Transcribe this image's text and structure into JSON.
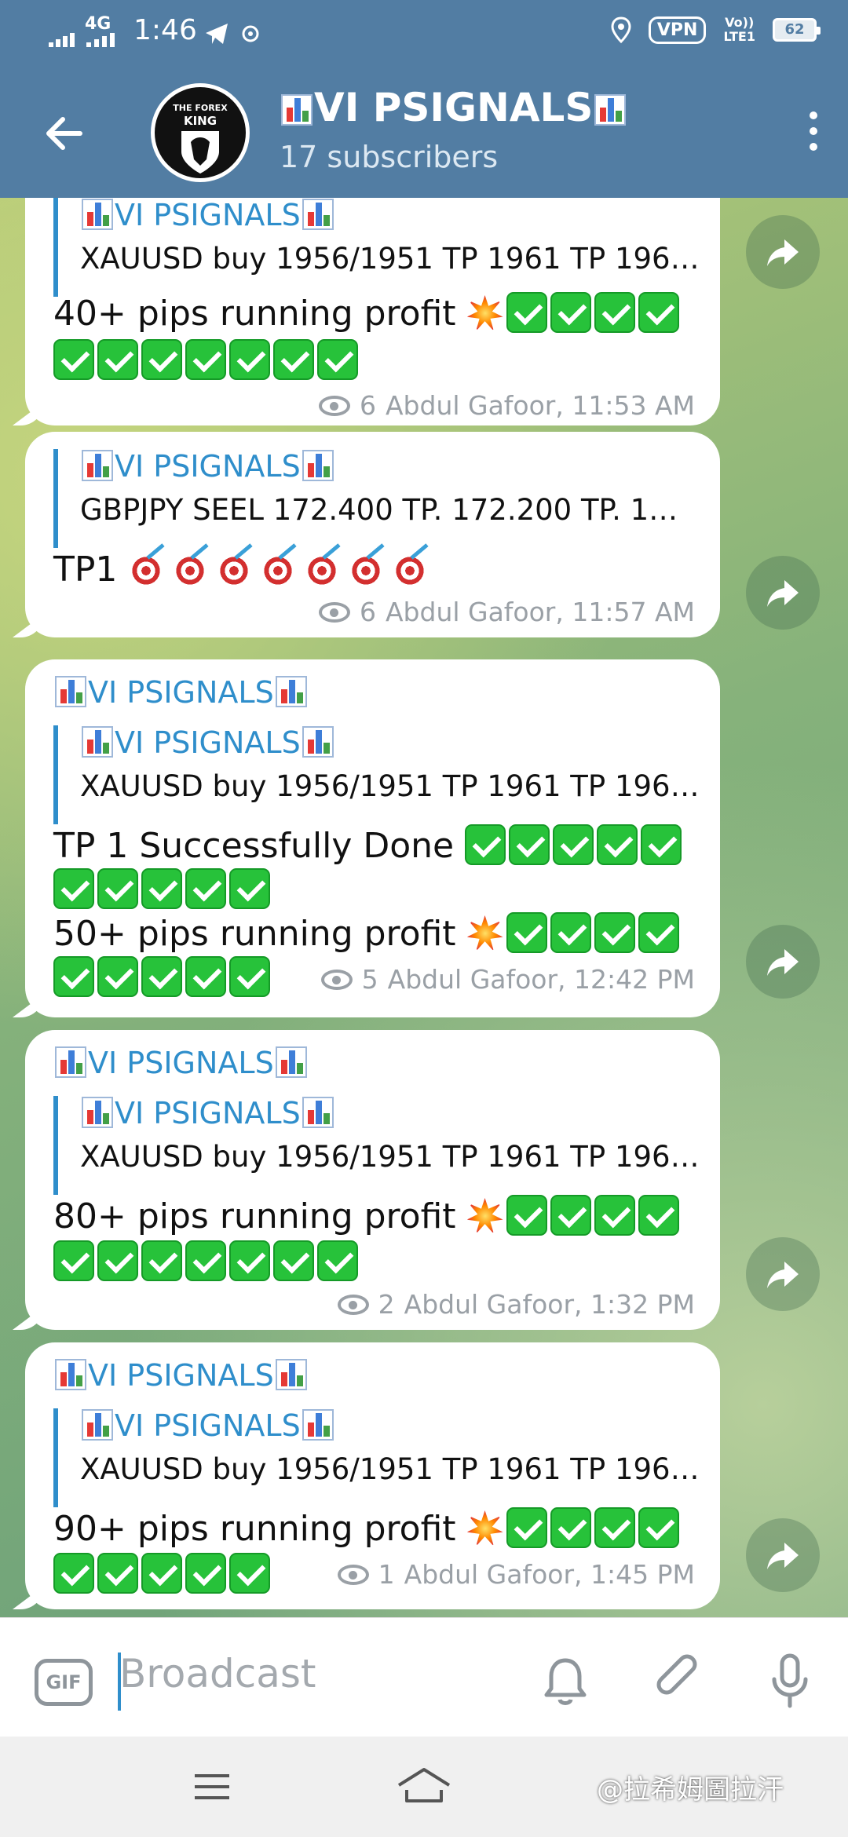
{
  "status_bar": {
    "signal_label": "4G",
    "time": "1:46",
    "vpn": "VPN",
    "lte_top": "Vo))",
    "lte_bottom": "LTE1",
    "battery": "62"
  },
  "header": {
    "avatar_line1": "THE FOREX",
    "avatar_line2": "KING",
    "title": "VI PSIGNALS",
    "subtitle": "17 subscribers"
  },
  "channel_name": "VI PSIGNALS",
  "messages": [
    {
      "reply_text": "XAUUSD buy 1956/1951 TP 1961 TP 196…",
      "lines": [
        "40+ pips running profit "
      ],
      "views": "6",
      "author_time": "Abdul Gafoor, 11:53 AM"
    },
    {
      "reply_text": "GBPJPY SEEL 172.400  TP. 172.200 TP. 1…",
      "lines": [
        "TP1 "
      ],
      "views": "6",
      "author_time": "Abdul Gafoor, 11:57 AM"
    },
    {
      "reply_text": "XAUUSD buy 1956/1951 TP 1961 TP 196…",
      "lines": [
        "TP 1 Successfully Done ",
        "50+ pips running profit "
      ],
      "views": "5",
      "author_time": "Abdul Gafoor, 12:42 PM"
    },
    {
      "reply_text": "XAUUSD buy 1956/1951 TP 1961 TP 196…",
      "lines": [
        "80+ pips running profit "
      ],
      "views": "2",
      "author_time": "Abdul Gafoor, 1:32 PM"
    },
    {
      "reply_text": "XAUUSD buy 1956/1951 TP 1961 TP 196…",
      "lines": [
        "90+ pips running profit "
      ],
      "views": "1",
      "author_time": "Abdul Gafoor, 1:45 PM"
    }
  ],
  "input_bar": {
    "gif_label": "GIF",
    "placeholder": "Broadcast"
  },
  "watermark": "@拉希姆圖拉汗",
  "icons": [
    "back-arrow-icon",
    "more-vert-icon",
    "eye-icon",
    "share-icon",
    "bell-icon",
    "paperclip-icon",
    "microphone-icon",
    "location-icon",
    "telegram-icon",
    "bar-chart-emoji",
    "check-mark-emoji",
    "collision-emoji",
    "direct-hit-emoji"
  ],
  "colors": {
    "header_bg": "#527da3",
    "accent": "#2f8ecb",
    "bubble_bg": "#ffffff",
    "meta_text": "#9aa0a6"
  }
}
